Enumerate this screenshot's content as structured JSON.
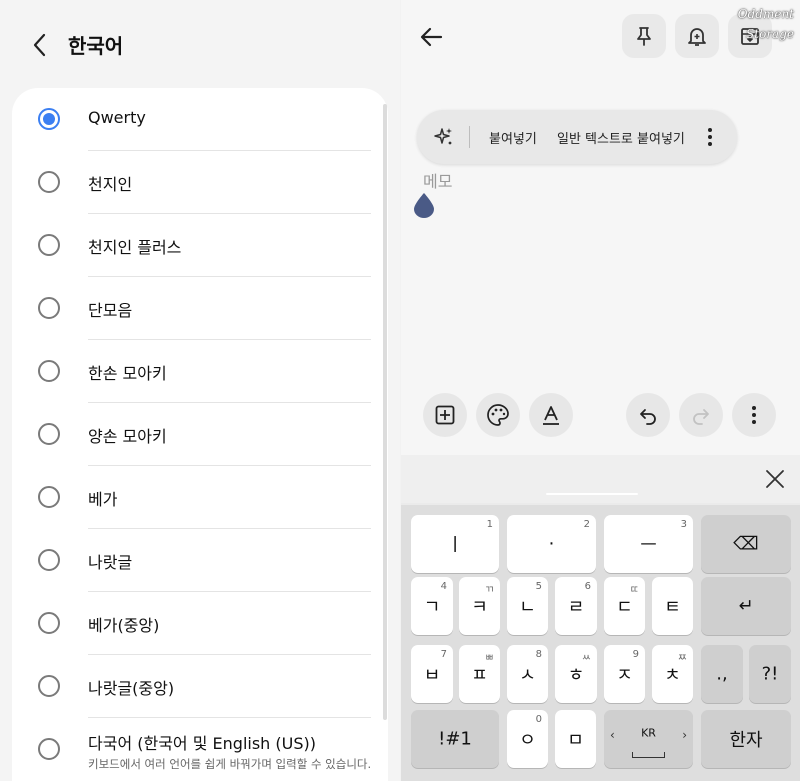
{
  "left_panel": {
    "title": "한국어",
    "options": [
      {
        "label": "Qwerty",
        "selected": true
      },
      {
        "label": "천지인",
        "selected": false
      },
      {
        "label": "천지인 플러스",
        "selected": false
      },
      {
        "label": "단모음",
        "selected": false
      },
      {
        "label": "한손 모아키",
        "selected": false
      },
      {
        "label": "양손 모아키",
        "selected": false
      },
      {
        "label": "베가",
        "selected": false
      },
      {
        "label": "나랏글",
        "selected": false
      },
      {
        "label": "베가(중앙)",
        "selected": false
      },
      {
        "label": "나랏글(중앙)",
        "selected": false
      },
      {
        "label": "다국어 (한국어 및 English (US))",
        "sublabel": "키보드에서 여러 언어를 쉽게 바꿔가며 입력할 수 있습니다.",
        "selected": false
      }
    ],
    "accent_color": "#3b7ff2"
  },
  "editor": {
    "watermark": [
      "Oddment",
      "Storage"
    ],
    "placeholder": "메모",
    "context_menu": {
      "paste_label": "붙여넣기",
      "paste_plain_label": "일반 텍스트로 붙여넣기"
    },
    "toolbar_icons": [
      "pin-icon",
      "reminder-bell-icon",
      "archive-icon"
    ],
    "bottom_icons": [
      "add-box-icon",
      "palette-icon",
      "text-format-icon",
      "undo-icon",
      "redo-icon",
      "more-vert-icon"
    ]
  },
  "keyboard": {
    "rows": [
      [
        {
          "main": "ㅣ",
          "hint": "1"
        },
        {
          "main": "·",
          "hint": "2"
        },
        {
          "main": "ㅡ",
          "hint": "3"
        },
        {
          "main": "⌫",
          "func": true
        }
      ],
      [
        {
          "main": "ㄱ",
          "hint": "4"
        },
        {
          "main": "ㅋ",
          "hint": "ㄲ"
        },
        {
          "main": "ㄴ",
          "hint": "5"
        },
        {
          "main": "ㄹ",
          "hint": "6"
        },
        {
          "main": "ㄷ",
          "hint": "ㄸ"
        },
        {
          "main": "ㅌ",
          "hint": ""
        },
        {
          "main": "↵",
          "func": true
        }
      ],
      [
        {
          "main": "ㅂ",
          "hint": "7"
        },
        {
          "main": "ㅍ",
          "hint": "ㅃ"
        },
        {
          "main": "ㅅ",
          "hint": "8"
        },
        {
          "main": "ㅎ",
          "hint": "ㅆ"
        },
        {
          "main": "ㅈ",
          "hint": "9"
        },
        {
          "main": "ㅊ",
          "hint": "ㅉ"
        },
        {
          "main": ".,",
          "func": true
        },
        {
          "main": "?!",
          "func": true
        }
      ],
      [
        {
          "main": "!#1",
          "func": true
        },
        {
          "main": "ㅇ",
          "hint": "0"
        },
        {
          "main": "ㅁ",
          "hint": ""
        },
        {
          "main": "KR",
          "func": true
        },
        {
          "main": "한자",
          "func": true
        }
      ]
    ]
  }
}
